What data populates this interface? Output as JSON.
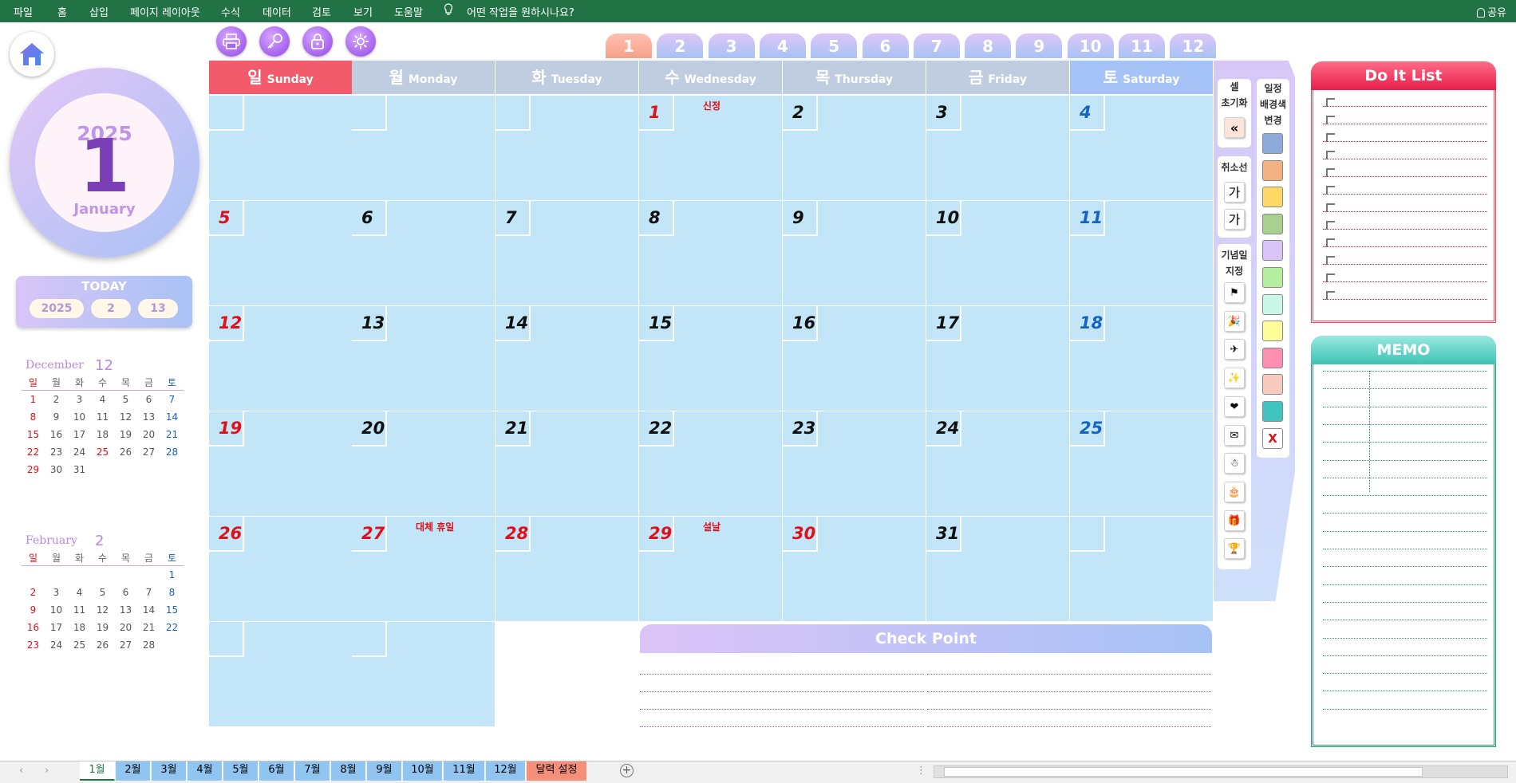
{
  "ribbon": {
    "menu": [
      "파일",
      "홈",
      "삽입",
      "페이지 레이아웃",
      "수식",
      "데이터",
      "검토",
      "보기",
      "도움말"
    ],
    "tell": "어떤 작업을 원하시나요?",
    "share": "공유"
  },
  "clock": {
    "year": "2025",
    "month_num": "1",
    "month_name": "January"
  },
  "today": {
    "title": "TODAY",
    "year": "2025",
    "month": "2",
    "day": "13"
  },
  "mini_prev": {
    "name": "December",
    "num": "12",
    "headers": [
      "일",
      "월",
      "화",
      "수",
      "목",
      "금",
      "토"
    ],
    "rows": [
      [
        "1",
        "2",
        "3",
        "4",
        "5",
        "6",
        "7"
      ],
      [
        "8",
        "9",
        "10",
        "11",
        "12",
        "13",
        "14"
      ],
      [
        "15",
        "16",
        "17",
        "18",
        "19",
        "20",
        "21"
      ],
      [
        "22",
        "23",
        "24",
        "25",
        "26",
        "27",
        "28"
      ],
      [
        "29",
        "30",
        "31",
        "",
        "",
        "",
        ""
      ]
    ],
    "holidays": [
      "25"
    ]
  },
  "mini_next": {
    "name": "February",
    "num": "2",
    "headers": [
      "일",
      "월",
      "화",
      "수",
      "목",
      "금",
      "토"
    ],
    "rows": [
      [
        "",
        "",
        "",
        "",
        "",
        "",
        "1"
      ],
      [
        "2",
        "3",
        "4",
        "5",
        "6",
        "7",
        "8"
      ],
      [
        "9",
        "10",
        "11",
        "12",
        "13",
        "14",
        "15"
      ],
      [
        "16",
        "17",
        "18",
        "19",
        "20",
        "21",
        "22"
      ],
      [
        "23",
        "24",
        "25",
        "26",
        "27",
        "28",
        ""
      ]
    ],
    "holidays": []
  },
  "top_icons": [
    "printer-icon",
    "key-icon",
    "lock-icon",
    "gear-icon"
  ],
  "month_tabs": [
    "1",
    "2",
    "3",
    "4",
    "5",
    "6",
    "7",
    "8",
    "9",
    "10",
    "11",
    "12"
  ],
  "active_month": "1",
  "days": [
    {
      "k": "일",
      "e": "Sunday"
    },
    {
      "k": "월",
      "e": "Monday"
    },
    {
      "k": "화",
      "e": "Tuesday"
    },
    {
      "k": "수",
      "e": "Wednesday"
    },
    {
      "k": "목",
      "e": "Thursday"
    },
    {
      "k": "금",
      "e": "Friday"
    },
    {
      "k": "토",
      "e": "Saturday"
    }
  ],
  "weeks": [
    [
      {
        "n": ""
      },
      {
        "n": ""
      },
      {
        "n": ""
      },
      {
        "n": "1",
        "c": "red",
        "h": "신정"
      },
      {
        "n": "2"
      },
      {
        "n": "3"
      },
      {
        "n": "4",
        "c": "blue"
      }
    ],
    [
      {
        "n": "5",
        "c": "red"
      },
      {
        "n": "6"
      },
      {
        "n": "7"
      },
      {
        "n": "8"
      },
      {
        "n": "9"
      },
      {
        "n": "10"
      },
      {
        "n": "11",
        "c": "blue"
      }
    ],
    [
      {
        "n": "12",
        "c": "red"
      },
      {
        "n": "13"
      },
      {
        "n": "14"
      },
      {
        "n": "15"
      },
      {
        "n": "16"
      },
      {
        "n": "17"
      },
      {
        "n": "18",
        "c": "blue"
      }
    ],
    [
      {
        "n": "19",
        "c": "red"
      },
      {
        "n": "20"
      },
      {
        "n": "21"
      },
      {
        "n": "22"
      },
      {
        "n": "23"
      },
      {
        "n": "24"
      },
      {
        "n": "25",
        "c": "blue"
      }
    ],
    [
      {
        "n": "26",
        "c": "red"
      },
      {
        "n": "27",
        "c": "red",
        "h": "대체 휴일"
      },
      {
        "n": "28",
        "c": "red"
      },
      {
        "n": "29",
        "c": "red",
        "h": "설날"
      },
      {
        "n": "30",
        "c": "red"
      },
      {
        "n": "31"
      },
      {
        "n": ""
      }
    ],
    [
      {
        "n": ""
      },
      {
        "n": ""
      }
    ]
  ],
  "side": {
    "reset_label_1": "셀",
    "reset_label_2": "초기화",
    "reset_btn": "«",
    "strike_label": "취소선",
    "strike_btn_1": "가",
    "strike_btn_2": "가",
    "anniv_label_1": "기념일",
    "anniv_label_2": "지정",
    "anniv_icons": [
      "⚑",
      "🎉",
      "✈",
      "✨",
      "❤",
      "✉",
      "☃",
      "🎂",
      "🎁",
      "🏆"
    ],
    "color_label_1": "일정",
    "color_label_2": "배경색",
    "color_label_3": "변경",
    "colors": [
      "#8eaadb",
      "#f4b183",
      "#ffd966",
      "#a9d18e",
      "#d9c3f7",
      "#b4f0a0",
      "#c9f7e8",
      "#ffff99",
      "#ff8fb0",
      "#f8cbbd",
      "#40c4c0"
    ],
    "clear_btn": "X"
  },
  "checkpoint": {
    "title": "Check Point"
  },
  "doit": {
    "title": "Do It List"
  },
  "memo": {
    "title": "MEMO"
  },
  "sheet_tabs": [
    "1월",
    "2월",
    "3월",
    "4월",
    "5월",
    "6월",
    "7월",
    "8월",
    "9월",
    "10월",
    "11월",
    "12월",
    "달력 설정"
  ],
  "colors": {
    "ribbon": "#217346",
    "cell": "#c2e6f7",
    "sunday": "#f15b6c",
    "saturday": "#a6c3f7",
    "accent": "#9046e6"
  }
}
